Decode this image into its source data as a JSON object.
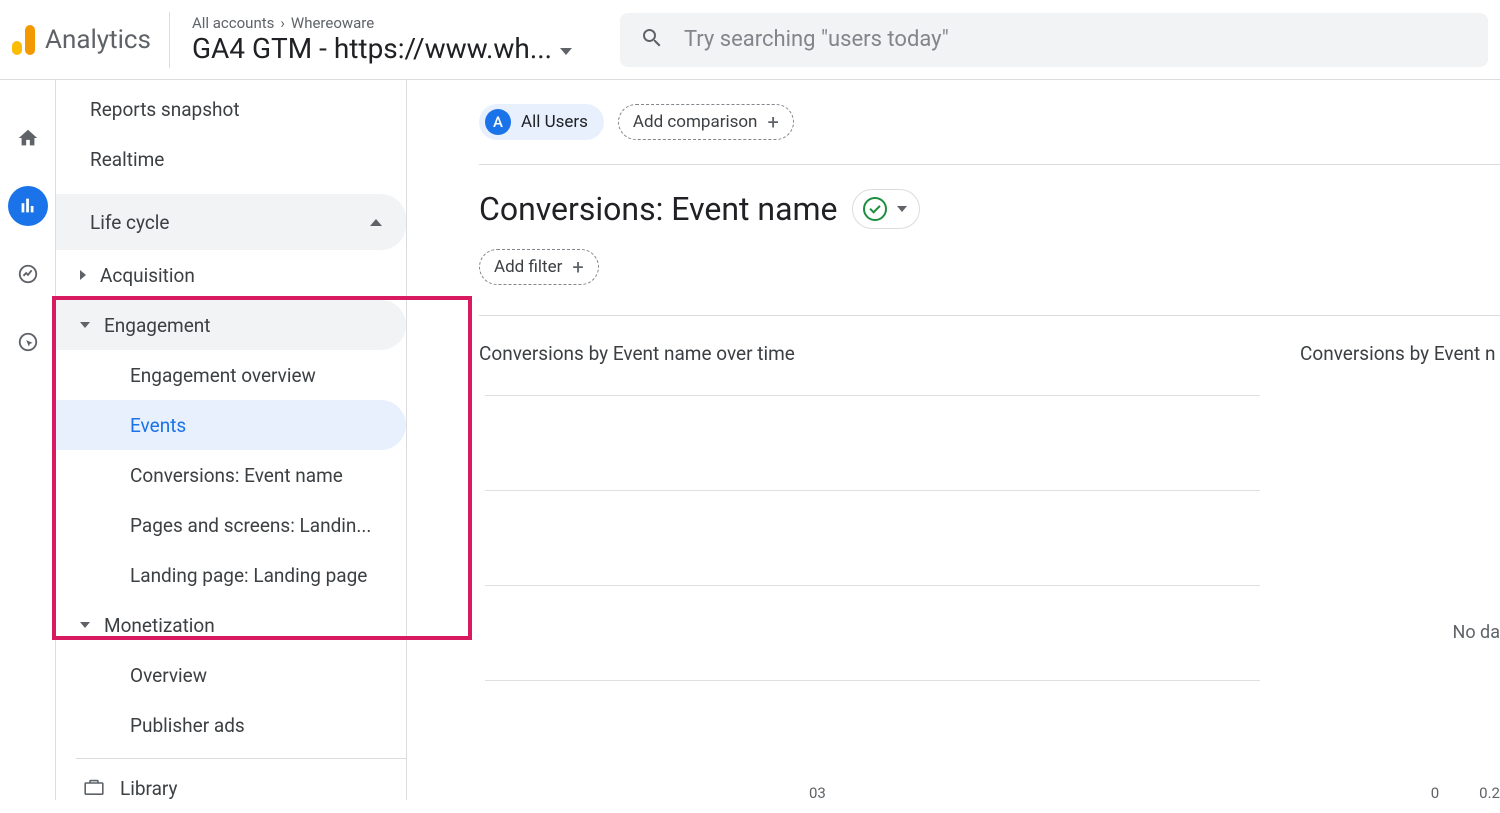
{
  "header": {
    "product": "Analytics",
    "breadcrumb_all": "All accounts",
    "breadcrumb_sep": "›",
    "breadcrumb_account": "Whereoware",
    "property": "GA4 GTM - https://www.wh...",
    "search_placeholder": "Try searching \"users today\""
  },
  "reportNav": {
    "snapshot": "Reports snapshot",
    "realtime": "Realtime",
    "section": "Life cycle",
    "groups": {
      "acquisition": "Acquisition",
      "engagement": "Engagement",
      "monetization": "Monetization"
    },
    "engagementChildren": {
      "overview": "Engagement overview",
      "events": "Events",
      "conversions": "Conversions: Event name",
      "pages": "Pages and screens: Landin...",
      "landing": "Landing page: Landing page"
    },
    "monetizationChildren": {
      "overview": "Overview",
      "publisher": "Publisher ads"
    },
    "library": "Library"
  },
  "main": {
    "segment_badge": "A",
    "segment_label": "All Users",
    "add_comparison": "Add comparison",
    "title": "Conversions: Event name",
    "add_filter": "Add filter",
    "chart_left_title": "Conversions by Event name over time",
    "chart_right_title": "Conversions by Event n",
    "no_data": "No da",
    "x_tick": "03",
    "y_tick0": "0",
    "y_tick1": "0.2"
  }
}
